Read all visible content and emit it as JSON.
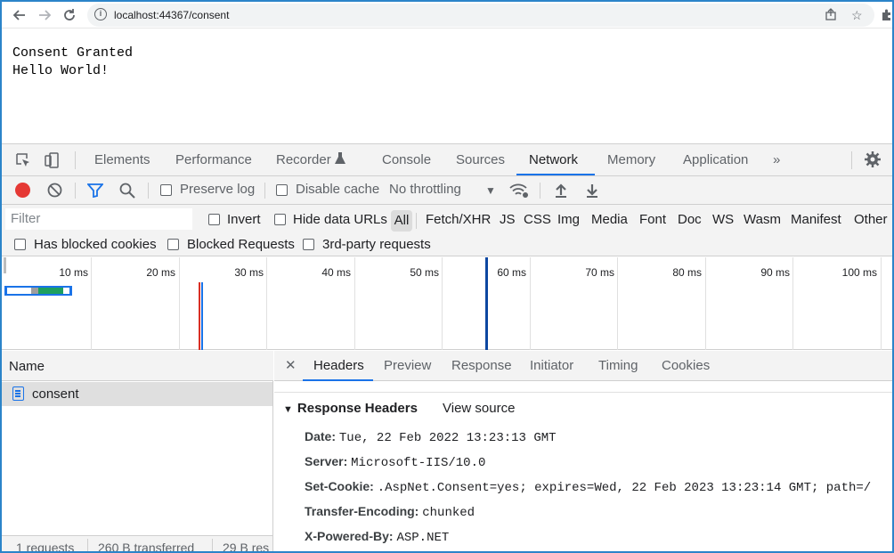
{
  "browser": {
    "url": "localhost:44367/consent"
  },
  "page": {
    "line1": "Consent Granted",
    "line2": "Hello World!"
  },
  "devtools": {
    "tabs": [
      "Elements",
      "Performance",
      "Recorder",
      "Console",
      "Sources",
      "Network",
      "Memory",
      "Application"
    ],
    "active_tab": "Network",
    "more_tabs": "»",
    "toolbar": {
      "preserve_log": "Preserve log",
      "disable_cache": "Disable cache",
      "throttling": "No throttling"
    },
    "filter": {
      "placeholder": "Filter",
      "invert": "Invert",
      "hide_data_urls": "Hide data URLs",
      "types": [
        "All",
        "Fetch/XHR",
        "JS",
        "CSS",
        "Img",
        "Media",
        "Font",
        "Doc",
        "WS",
        "Wasm",
        "Manifest",
        "Other"
      ],
      "has_blocked_cookies": "Has blocked cookies",
      "blocked_requests": "Blocked Requests",
      "third_party": "3rd-party requests"
    },
    "timeline_ticks": [
      "10 ms",
      "20 ms",
      "30 ms",
      "40 ms",
      "50 ms",
      "60 ms",
      "70 ms",
      "80 ms",
      "90 ms",
      "100 ms"
    ],
    "requests": {
      "column": "Name",
      "rows": [
        "consent"
      ],
      "status": {
        "count": "1 requests",
        "transferred": "260 B transferred",
        "resources": "29 B res"
      }
    },
    "detail": {
      "tabs": [
        "Headers",
        "Preview",
        "Response",
        "Initiator",
        "Timing",
        "Cookies"
      ],
      "active_tab": "Headers",
      "section": "Response Headers",
      "view_source": "View source",
      "headers": [
        {
          "name": "Date:",
          "value": "Tue, 22 Feb 2022 13:23:13 GMT"
        },
        {
          "name": "Server:",
          "value": "Microsoft-IIS/10.0"
        },
        {
          "name": "Set-Cookie:",
          "value": ".AspNet.Consent=yes; expires=Wed, 22 Feb 2023 13:23:14 GMT; path=/"
        },
        {
          "name": "Transfer-Encoding:",
          "value": "chunked"
        },
        {
          "name": "X-Powered-By:",
          "value": "ASP.NET"
        }
      ]
    }
  },
  "colors": {
    "accent": "#1a73e8",
    "record": "#e53935",
    "frame": "#2b84c9"
  }
}
